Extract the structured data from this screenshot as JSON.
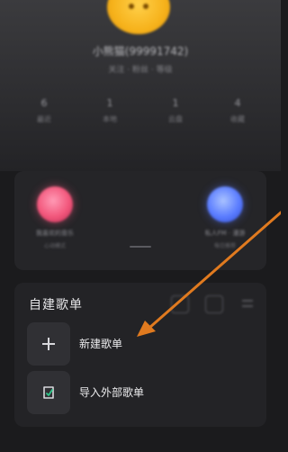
{
  "profile": {
    "username": "小熊猫(99991742)",
    "subinfo": "关注 · 粉丝 · 等级",
    "stats": [
      {
        "value": "6",
        "label": "最近"
      },
      {
        "value": "1",
        "label": "本地"
      },
      {
        "value": "1",
        "label": "云盘"
      },
      {
        "value": "4",
        "label": "收藏"
      }
    ]
  },
  "radio": {
    "left_label": "我喜欢的音乐",
    "left_sub": "心动模式",
    "right_label": "私人FM · 漫游",
    "right_sub": "每日推荐"
  },
  "playlists": {
    "section_title": "自建歌单",
    "new_label": "新建歌单",
    "import_label": "导入外部歌单"
  },
  "colors": {
    "annotation_arrow": "#e07a1f",
    "background": "#1b1b1d"
  }
}
